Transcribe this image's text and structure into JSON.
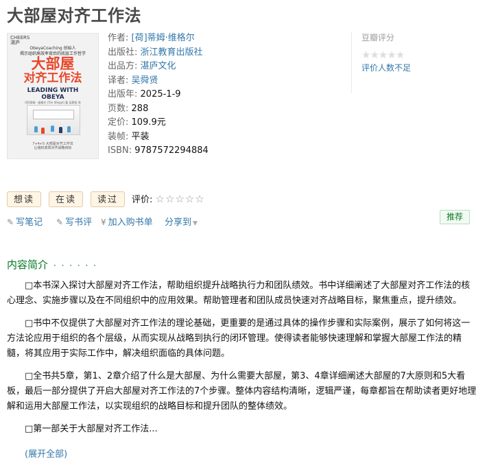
{
  "book": {
    "title": "大部屋对齐工作法",
    "cover": {
      "publisher_logo": "CHEERS\n湛庐",
      "tagline": "ObeyaCoaching 创始人\n揭示组织高效率背后的底层工作哲学",
      "title_line1": "大部屋",
      "title_line2": "对齐工作法",
      "english_title": "LEADING WITH\nOBEYA",
      "author_line": "[荷]蒂姆 · 维格尔 (Tim Wiegel) 著  吴舜贤 译",
      "bottom_note": "7+4+5 大部屋对齐工作法\n让组织高效对齐战略目标"
    },
    "info": [
      {
        "label": "作者:",
        "value": "[荷]蒂姆·维格尔",
        "link": true
      },
      {
        "label": "出版社:",
        "value": "浙江教育出版社",
        "link": true
      },
      {
        "label": "出品方:",
        "value": "湛庐文化",
        "link": true
      },
      {
        "label": "译者:",
        "value": "吴舜贤",
        "link": true
      },
      {
        "label": "出版年:",
        "value": "2025-1-9",
        "link": false
      },
      {
        "label": "页数:",
        "value": "288",
        "link": false
      },
      {
        "label": "定价:",
        "value": "109.9元",
        "link": false
      },
      {
        "label": "装帧:",
        "value": "平装",
        "link": false
      },
      {
        "label": "ISBN:",
        "value": "9787572294884",
        "link": false
      }
    ]
  },
  "rating": {
    "label": "豆瓣评分",
    "stars": "★★★★★",
    "no_ratings_text": "评价人数不足"
  },
  "buttons": {
    "want_read": "想读",
    "reading": "在读",
    "read": "读过",
    "my_rating_label": "评价:",
    "my_rating_stars": "☆☆☆☆☆"
  },
  "actions": {
    "write_note": "写笔记",
    "write_review": "写书评",
    "add_cart": "加入购书单",
    "share": "分享到",
    "recommend": "推荐"
  },
  "intro": {
    "heading": "内容简介",
    "dots": "· · · · · ·",
    "paragraphs": [
      "□本书深入探讨大部屋对齐工作法，帮助组织提升战略执行力和团队绩效。书中详细阐述了大部屋对齐工作法的核心理念、实施步骤以及在不同组织中的应用效果。帮助管理者和团队成员快速对齐战略目标，聚焦重点，提升绩效。",
      "□书中不仅提供了大部屋对齐工作法的理论基础，更重要的是通过具体的操作步骤和实际案例，展示了如何将这一方法论应用于组织的各个层级，从而实现从战略到执行的闭环管理。使得读者能够快速理解和掌握大部屋工作法的精髓，将其应用于实际工作中，解决组织面临的具体问题。",
      "□全书共5章，第1、2章介绍了什么是大部屋、为什么需要大部屋，第3、4章详细阐述大部屋的7大原则和5大看板，最后一部分提供了开启大部屋对齐工作法的7个步骤。整体内容结构清晰，逻辑严谨，每章都旨在帮助读者更好地理解和运用大部屋工作法，以实现组织的战略目标和提升团队的整体绩效。",
      "□第一部关于大部屋对齐工作法..."
    ],
    "expand": "(展开全部)"
  },
  "colors": {
    "link": "#3377aa",
    "green": "#007722",
    "cover_red": "#e8472a"
  }
}
